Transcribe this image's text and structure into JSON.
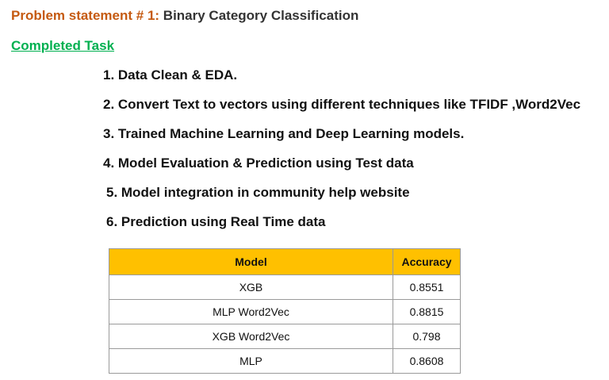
{
  "header": {
    "problem_prefix": "Problem statement # 1:",
    "problem_title": "Binary Category Classification"
  },
  "section": {
    "completed_label": "Completed Task"
  },
  "tasks": [
    "1. Data Clean & EDA.",
    "2. Convert Text to vectors using different techniques like TFIDF ,Word2Vec",
    "3. Trained Machine Learning and Deep Learning models.",
    "4. Model Evaluation & Prediction using Test data",
    "5. Model integration in community help website",
    "6. Prediction using Real Time data"
  ],
  "table": {
    "headers": [
      "Model",
      "Accuracy"
    ],
    "rows": [
      [
        "XGB",
        "0.8551"
      ],
      [
        "MLP Word2Vec",
        "0.8815"
      ],
      [
        "XGB Word2Vec",
        "0.798"
      ],
      [
        "MLP",
        "0.8608"
      ]
    ]
  },
  "colors": {
    "title_accent": "#c55a11",
    "completed_accent": "#00b050",
    "table_header_bg": "#ffc000"
  }
}
